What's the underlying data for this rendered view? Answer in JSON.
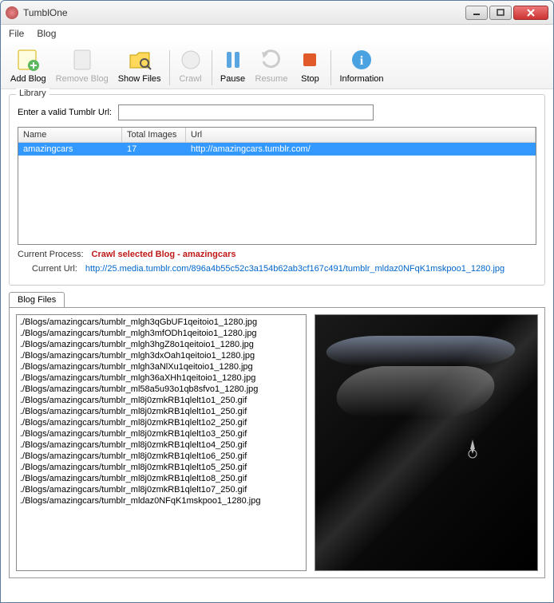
{
  "window": {
    "title": "TumblOne"
  },
  "menu": {
    "file": "File",
    "blog": "Blog"
  },
  "toolbar": {
    "add_blog": "Add Blog",
    "remove_blog": "Remove Blog",
    "show_files": "Show Files",
    "crawl": "Crawl",
    "pause": "Pause",
    "resume": "Resume",
    "stop": "Stop",
    "information": "Information"
  },
  "library": {
    "title": "Library",
    "url_label": "Enter a valid Tumblr Url:",
    "url_value": "",
    "columns": {
      "name": "Name",
      "total": "Total Images",
      "url": "Url"
    },
    "rows": [
      {
        "name": "amazingcars",
        "total": "17",
        "url": "http://amazingcars.tumblr.com/"
      }
    ],
    "current_process_label": "Current Process:",
    "current_process": "Crawl selected Blog -  amazingcars",
    "current_url_label": "Current Url:",
    "current_url": "http://25.media.tumblr.com/896a4b55c52c3a154b62ab3cf167c491/tumblr_mldaz0NFqK1mskpoo1_1280.jpg"
  },
  "blog_files": {
    "tab": "Blog Files",
    "files": [
      "./Blogs/amazingcars/tumblr_mlgh3qGbUF1qeitoio1_1280.jpg",
      "./Blogs/amazingcars/tumblr_mlgh3mfODh1qeitoio1_1280.jpg",
      "./Blogs/amazingcars/tumblr_mlgh3hgZ8o1qeitoio1_1280.jpg",
      "./Blogs/amazingcars/tumblr_mlgh3dxOah1qeitoio1_1280.jpg",
      "./Blogs/amazingcars/tumblr_mlgh3aNlXu1qeitoio1_1280.jpg",
      "./Blogs/amazingcars/tumblr_mlgh36aXHh1qeitoio1_1280.jpg",
      "./Blogs/amazingcars/tumblr_ml58a5u93o1qb8sfvo1_1280.jpg",
      "./Blogs/amazingcars/tumblr_ml8j0zmkRB1qlelt1o1_250.gif",
      "./Blogs/amazingcars/tumblr_ml8j0zmkRB1qlelt1o1_250.gif",
      "./Blogs/amazingcars/tumblr_ml8j0zmkRB1qlelt1o2_250.gif",
      "./Blogs/amazingcars/tumblr_ml8j0zmkRB1qlelt1o3_250.gif",
      "./Blogs/amazingcars/tumblr_ml8j0zmkRB1qlelt1o4_250.gif",
      "./Blogs/amazingcars/tumblr_ml8j0zmkRB1qlelt1o6_250.gif",
      "./Blogs/amazingcars/tumblr_ml8j0zmkRB1qlelt1o5_250.gif",
      "./Blogs/amazingcars/tumblr_ml8j0zmkRB1qlelt1o8_250.gif",
      "./Blogs/amazingcars/tumblr_ml8j0zmkRB1qlelt1o7_250.gif",
      "./Blogs/amazingcars/tumblr_mldaz0NFqK1mskpoo1_1280.jpg"
    ]
  }
}
